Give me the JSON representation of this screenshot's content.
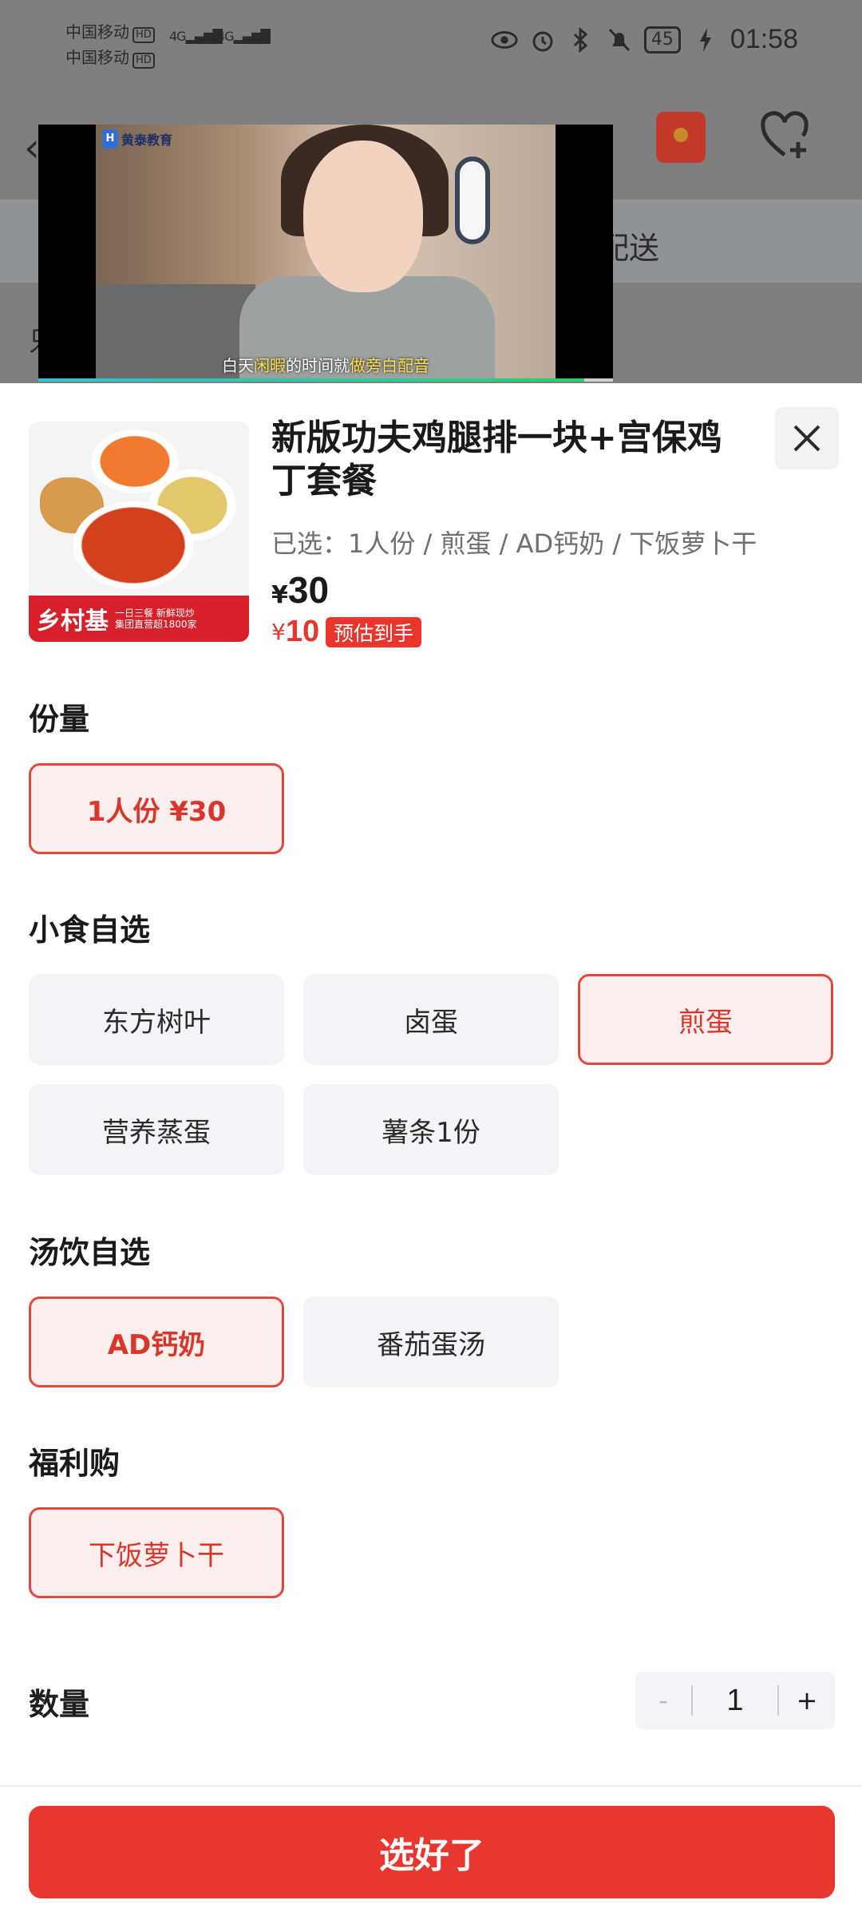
{
  "status_bar": {
    "carrier1": "中国移动",
    "carrier2": "中国移动",
    "hd": "HD",
    "net1": "4G",
    "net2": "4G",
    "battery": "45",
    "time": "01:58"
  },
  "background_page": {
    "tab_label": "配送",
    "row_label": "只"
  },
  "video": {
    "brand": "黄泰教育",
    "brand_logo": "H",
    "subtitle_parts": [
      "白天",
      "闲暇",
      "的时间就",
      "做旁白配音"
    ],
    "progress": 0.95
  },
  "product": {
    "title": "新版功夫鸡腿排一块+宫保鸡丁套餐",
    "selected": "已选：1人份 / 煎蛋 / AD钙奶 / 下饭萝卜干",
    "price_currency": "¥",
    "price": "30",
    "est_currency": "¥",
    "est_price": "10",
    "est_badge": "预估到手",
    "image_brand": "乡村基",
    "image_sub1": "一日三餐 新鲜现炒",
    "image_sub2": "集团直营超1800家"
  },
  "sections": {
    "portion": {
      "title": "份量",
      "options": [
        {
          "label": "1人份  ¥30",
          "selected": true
        }
      ]
    },
    "snack": {
      "title": "小食自选",
      "options": [
        {
          "label": "东方树叶",
          "selected": false
        },
        {
          "label": "卤蛋",
          "selected": false
        },
        {
          "label": "煎蛋",
          "selected": true
        },
        {
          "label": "营养蒸蛋",
          "selected": false
        },
        {
          "label": "薯条1份",
          "selected": false
        }
      ]
    },
    "drink": {
      "title": "汤饮自选",
      "options": [
        {
          "label": "AD钙奶",
          "selected": true
        },
        {
          "label": "番茄蛋汤",
          "selected": false
        }
      ]
    },
    "welfare": {
      "title": "福利购",
      "options": [
        {
          "label": "下饭萝卜干",
          "selected": true
        }
      ]
    }
  },
  "quantity": {
    "label": "数量",
    "minus": "-",
    "value": "1",
    "plus": "+"
  },
  "confirm_label": "选好了",
  "colors": {
    "accent": "#e8372e",
    "selected_bg": "#fdeeee",
    "option_bg": "#f2f4f7"
  }
}
